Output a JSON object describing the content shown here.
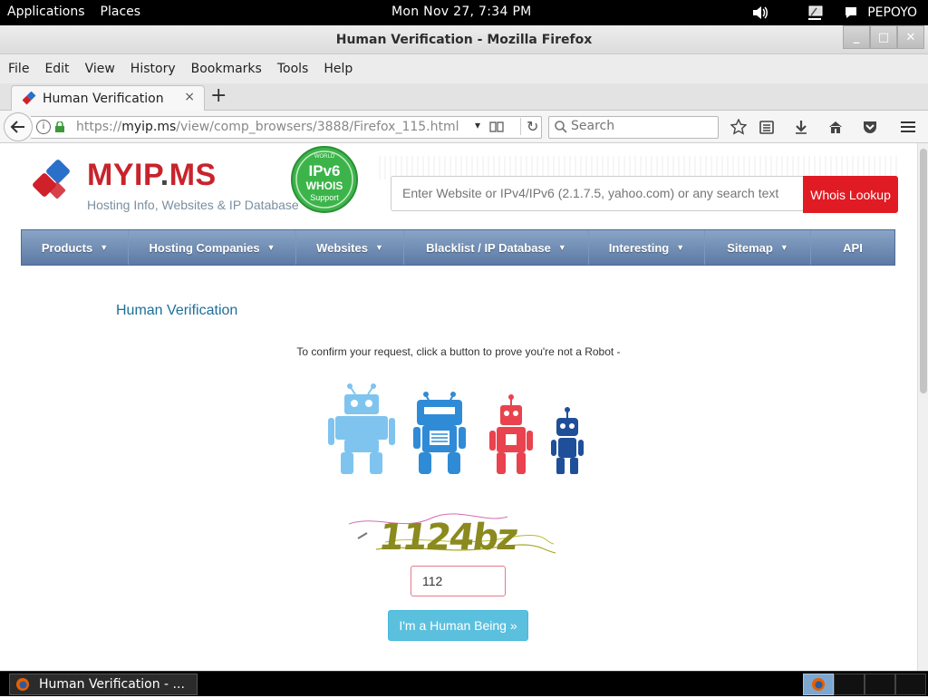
{
  "topbar": {
    "applications": "Applications",
    "places": "Places",
    "clock": "Mon Nov 27,  7:34 PM",
    "user": "PEPOYO",
    "volume_icon": "speaker-icon",
    "network_icon": "network-icon",
    "chat_icon": "chat-icon"
  },
  "window": {
    "title": "Human Verification - Mozilla Firefox",
    "minimize": "_",
    "maximize": "□",
    "close": "✕"
  },
  "menubar": {
    "file": "File",
    "edit": "Edit",
    "view": "View",
    "history": "History",
    "bookmarks": "Bookmarks",
    "tools": "Tools",
    "help": "Help"
  },
  "tab": {
    "label": "Human Verification",
    "close": "×",
    "new_tab": "+"
  },
  "navbar": {
    "url_host": "myip.ms",
    "url_prefix": "https://",
    "url_path": "/view/comp_browsers/3888/Firefox_115.html",
    "search_placeholder": "Search"
  },
  "site": {
    "brand_main": "MYIP",
    "brand_dot": ".",
    "brand_end": "MS",
    "tagline": "Hosting Info, Websites & IP Database",
    "badge_ipv6": "IPv6",
    "badge_whois": "WHOIS",
    "badge_support": "Support",
    "badge_world": "WORLD",
    "search_placeholder": "Enter Website or IPv4/IPv6 (2.1.7.5, yahoo.com) or any search text",
    "whois_button": "Whois Lookup",
    "nav": [
      {
        "label": "Products",
        "caret": "▼"
      },
      {
        "label": "Hosting Companies",
        "caret": "▼"
      },
      {
        "label": "Websites",
        "caret": "▼"
      },
      {
        "label": "Blacklist / IP Database",
        "caret": "▼"
      },
      {
        "label": "Interesting",
        "caret": "▼"
      },
      {
        "label": "Sitemap",
        "caret": "▼"
      },
      {
        "label": "API",
        "caret": ""
      }
    ]
  },
  "verification": {
    "title": "Human Verification",
    "instructions": "To confirm your request, click a button to prove you're not a Robot -",
    "captcha_text": "1124bz",
    "captcha_input_value": "112",
    "submit_button": "I'm a Human Being »"
  },
  "taskbar": {
    "item_label": "Human Verification - ..."
  },
  "colors": {
    "brand_red": "#c8232c",
    "whois_red": "#e01b24",
    "nav_blue": "#5c7aa5",
    "title_blue": "#1d6f99",
    "button_cyan": "#5bc0de",
    "captcha_olive": "#8a8a1e"
  }
}
